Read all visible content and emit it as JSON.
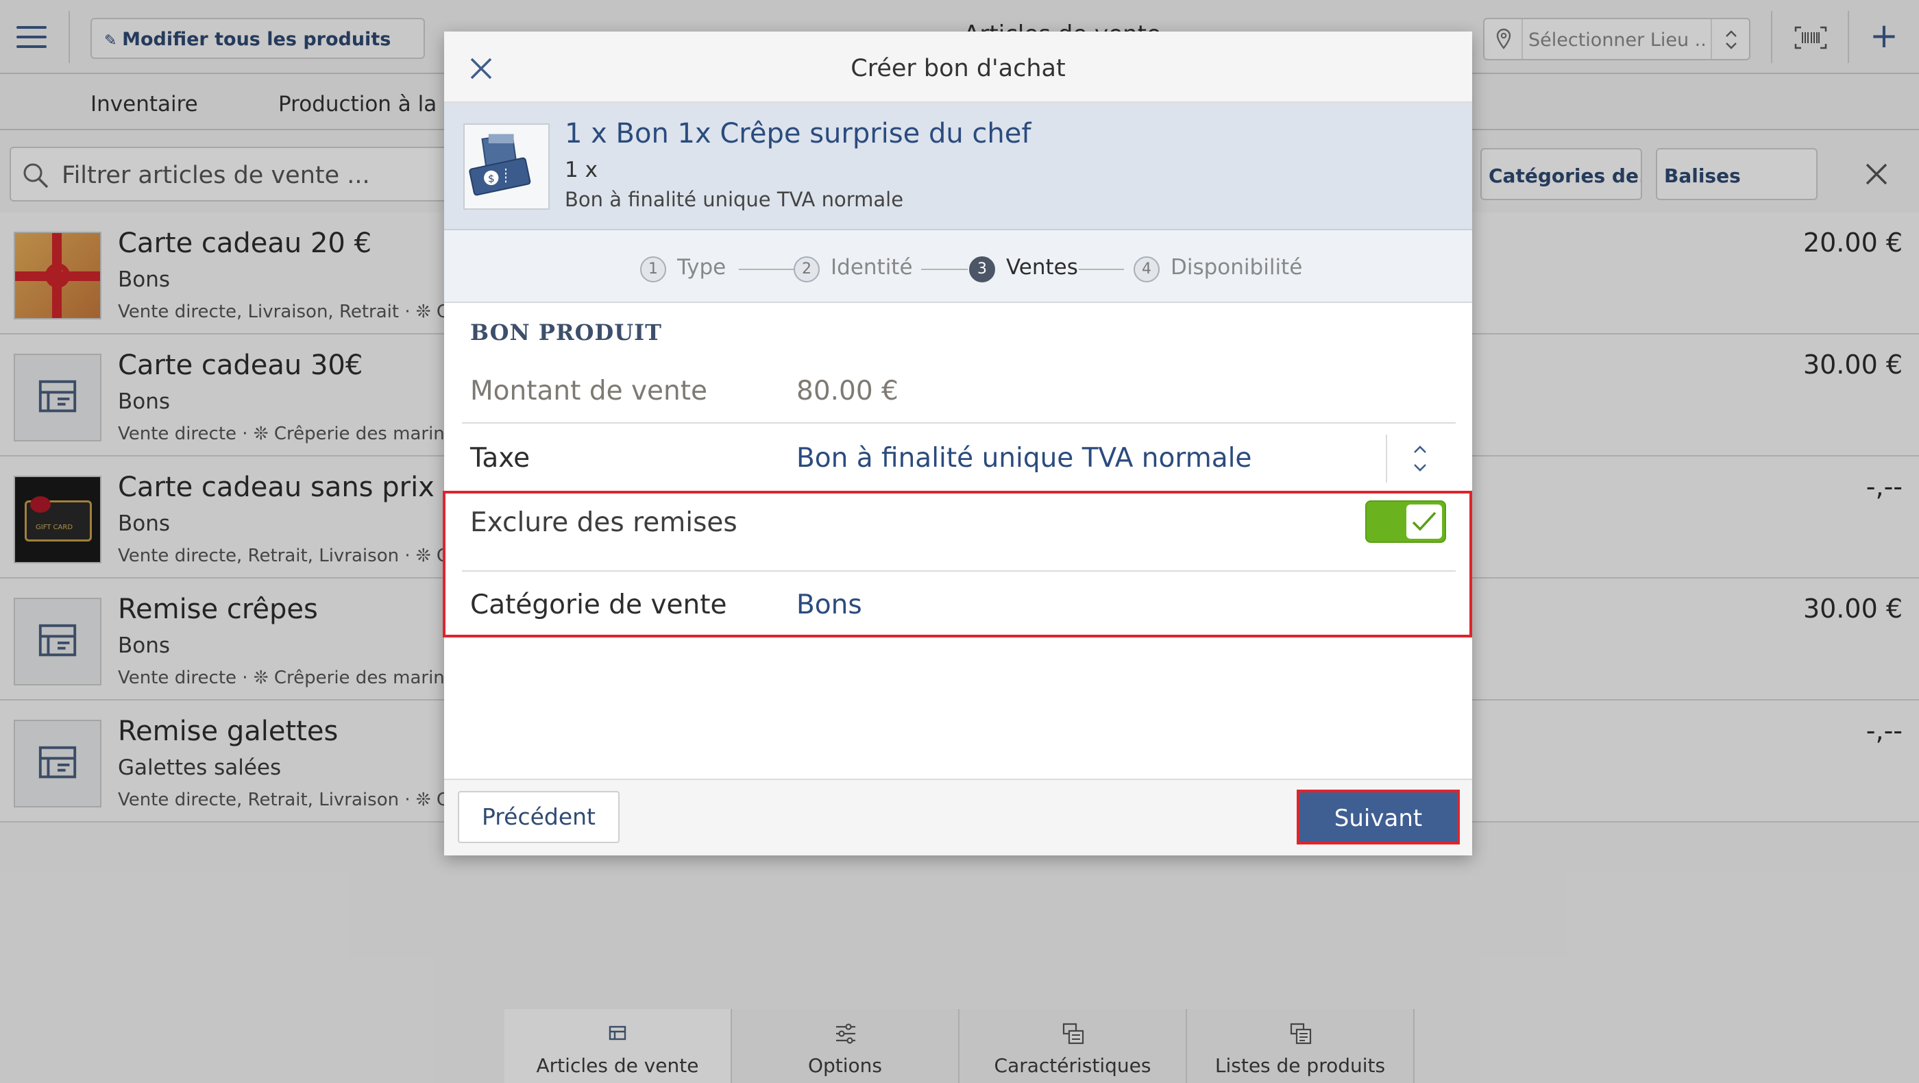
{
  "header": {
    "edit_all_label": "Modifier tous les produits",
    "page_title": "Articles de vente",
    "location_placeholder": "Sélectionner Lieu ......"
  },
  "tabs": [
    {
      "label": "Inventaire"
    },
    {
      "label": "Production à la de"
    }
  ],
  "filter": {
    "placeholder": "Filtrer articles de vente ...",
    "categories_label": "Catégories de...",
    "tags_label": "Balises"
  },
  "products": [
    {
      "name": "Carte cadeau 20 €",
      "category": "Bons",
      "channels": "Vente directe, Livraison, Retrait · ❊ Cr",
      "price": "20.00 €"
    },
    {
      "name": "Carte cadeau 30€",
      "category": "Bons",
      "channels": "Vente directe · ❊ Crêperie des marins",
      "price": "30.00 €"
    },
    {
      "name": "Carte cadeau sans prix",
      "category": "Bons",
      "channels": "Vente directe, Retrait, Livraison · ❊ Cr",
      "price": "-,--"
    },
    {
      "name": "Remise crêpes",
      "category": "Bons",
      "channels": "Vente directe · ❊ Crêperie des marins",
      "price": "30.00 €"
    },
    {
      "name": "Remise galettes",
      "category": "Galettes salées",
      "channels": "Vente directe, Retrait, Livraison · ❊ Cr",
      "price": "-,--"
    }
  ],
  "gift_card_text": "GIFT CARD",
  "bottom_nav": [
    {
      "label": "Articles de vente"
    },
    {
      "label": "Options"
    },
    {
      "label": "Caractéristiques"
    },
    {
      "label": "Listes de produits"
    }
  ],
  "modal": {
    "title": "Créer bon d'achat",
    "product_name": "1 x Bon 1x Crêpe surprise du chef",
    "quantity": "1 x",
    "product_tax": "Bon à finalité unique TVA normale",
    "steps": [
      {
        "num": "1",
        "label": "Type"
      },
      {
        "num": "2",
        "label": "Identité"
      },
      {
        "num": "3",
        "label": "Ventes"
      },
      {
        "num": "4",
        "label": "Disponibilité"
      }
    ],
    "section_title": "BON PRODUIT",
    "fields": {
      "amount_label": "Montant de vente",
      "amount_value": "80.00 €",
      "tax_label": "Taxe",
      "tax_value": "Bon à finalité unique TVA normale",
      "exclude_label": "Exclure des remises",
      "category_label": "Catégorie de vente",
      "category_value": "Bons"
    },
    "exclude_discounts_on": true,
    "prev_label": "Précédent",
    "next_label": "Suivant"
  },
  "colors": {
    "accent": "#3f5f93",
    "highlight": "#e0242b",
    "toggle_on": "#6ab31f"
  }
}
